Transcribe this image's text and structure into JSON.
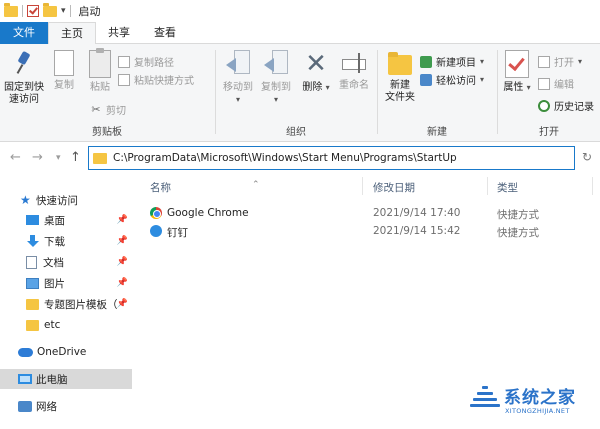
{
  "window": {
    "title": "启动"
  },
  "tabs": [
    "文件",
    "主页",
    "共享",
    "查看"
  ],
  "ribbon": {
    "clipboard": {
      "label": "剪贴板",
      "pin_l1": "固定到快",
      "pin_l2": "速访问",
      "copy": "复制",
      "paste": "粘贴",
      "copy_path": "复制路径",
      "paste_shortcut": "粘贴快捷方式",
      "cut": "剪切"
    },
    "organize": {
      "label": "组织",
      "move_to": "移动到",
      "copy_to": "复制到",
      "delete": "删除",
      "rename": "重命名"
    },
    "new": {
      "label": "新建",
      "new_folder_l1": "新建",
      "new_folder_l2": "文件夹",
      "new_item": "新建项目",
      "easy_access": "轻松访问"
    },
    "open": {
      "label": "打开",
      "properties": "属性",
      "open": "打开",
      "edit": "编辑",
      "history": "历史记录"
    }
  },
  "address": {
    "path": "C:\\ProgramData\\Microsoft\\Windows\\Start Menu\\Programs\\StartUp"
  },
  "columns": {
    "name": "名称",
    "date": "修改日期",
    "type": "类型"
  },
  "nav": {
    "quick_access": "快速访问",
    "desktop": "桌面",
    "downloads": "下载",
    "documents": "文档",
    "pictures": "图片",
    "special_folder": "专题图片模板（",
    "etc": "etc",
    "onedrive": "OneDrive",
    "this_pc": "此电脑",
    "network": "网络"
  },
  "files": [
    {
      "name": "Google Chrome",
      "date": "2021/9/14 17:40",
      "type": "快捷方式",
      "icon": "chrome-icon"
    },
    {
      "name": "钉钉",
      "date": "2021/9/14 15:42",
      "type": "快捷方式",
      "icon": "dingtalk-icon"
    }
  ],
  "watermark": {
    "text": "系统之家",
    "url": "XITONGZHIJIA.NET"
  },
  "colors": {
    "accent": "#1979ca",
    "folder": "#f5c542"
  }
}
